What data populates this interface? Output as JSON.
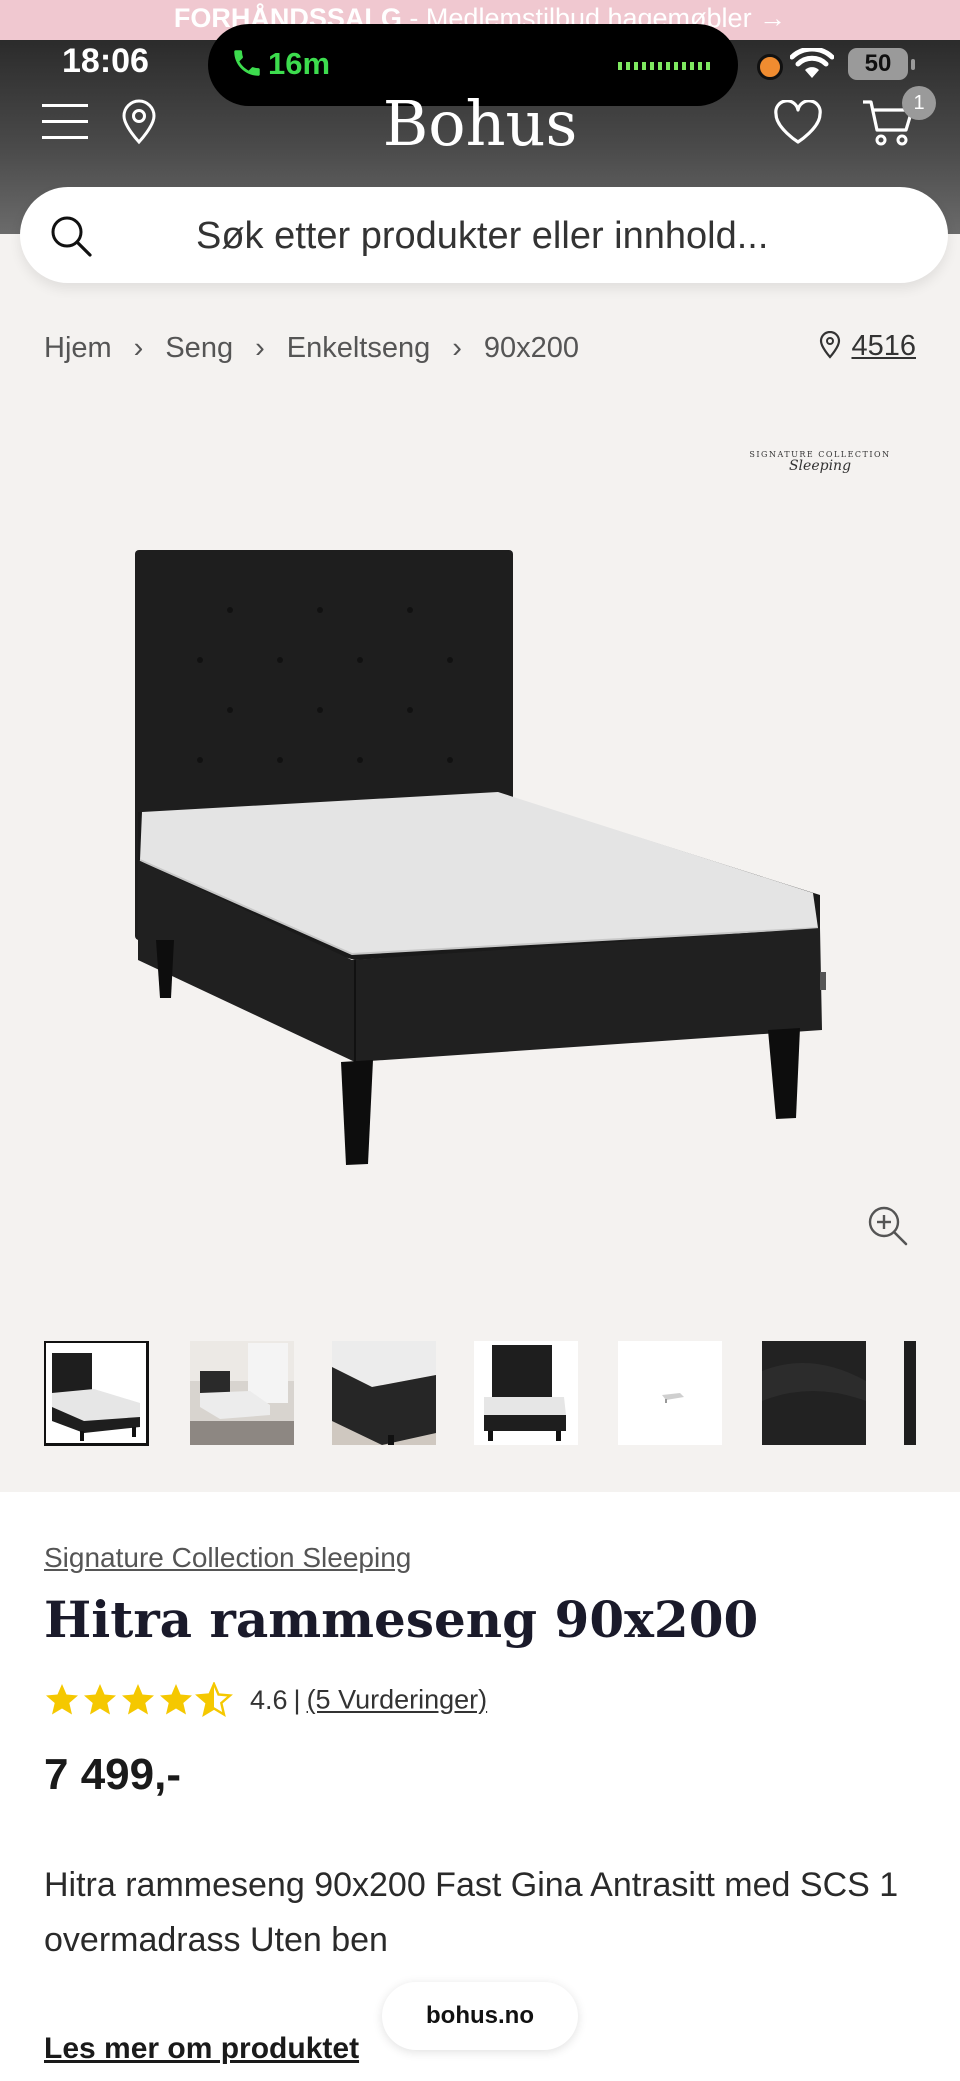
{
  "promo_banner": {
    "bold": "FORHÅNDSSALG",
    "text": " - Medlemstilbud hagemøbler →"
  },
  "status_bar": {
    "time": "18:06",
    "call_duration": "16m",
    "battery": "50"
  },
  "header": {
    "logo": "Bohus",
    "cart_count": "1"
  },
  "search": {
    "placeholder": "Søk etter produkter eller innhold..."
  },
  "breadcrumb": {
    "items": [
      "Hjem",
      "Seng",
      "Enkeltseng",
      "90x200"
    ],
    "separator": "›"
  },
  "store": {
    "number": "4516"
  },
  "gallery": {
    "brand_mark_line1": "SIGNATURE COLLECTION",
    "brand_mark_line2": "Sleeping"
  },
  "product": {
    "brand": "Signature Collection Sleeping",
    "title": "Hitra rammeseng 90x200",
    "rating": 4.6,
    "rating_text": "4.6",
    "rating_separator": "|",
    "review_count": "(5 Vurderinger)",
    "price": "7 499,-",
    "description": "Hitra rammeseng 90x200 Fast Gina Antrasitt med SCS 1 overmadrass Uten ben",
    "read_more": "Les mer om produktet"
  },
  "browser": {
    "url": "bohus.no"
  },
  "colors": {
    "star": "#f5c800",
    "header_dark": "#2b2b2b",
    "page_bg": "#f4f2f0",
    "call_green": "#3ddc4e"
  }
}
